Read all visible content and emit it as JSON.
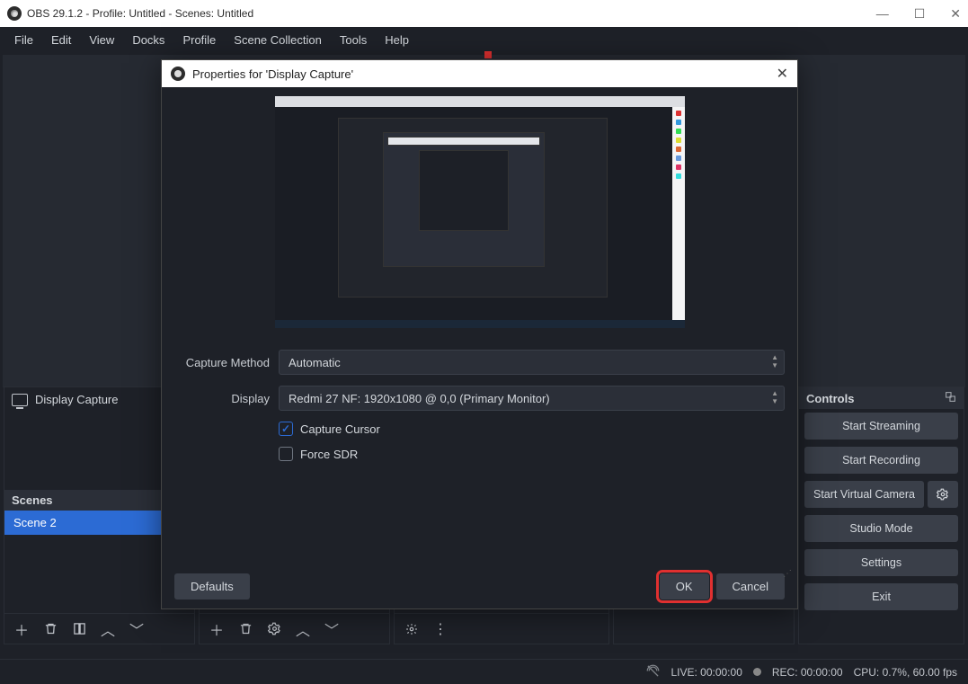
{
  "window": {
    "title": "OBS 29.1.2 - Profile: Untitled - Scenes: Untitled"
  },
  "menubar": [
    "File",
    "Edit",
    "View",
    "Docks",
    "Profile",
    "Scene Collection",
    "Tools",
    "Help"
  ],
  "panels": {
    "scenes": {
      "title": "Scenes",
      "items": [
        "Scene 2"
      ]
    },
    "sources": {
      "items": [
        "Display Capture"
      ]
    },
    "controls": {
      "title": "Controls",
      "buttons": {
        "start_streaming": "Start Streaming",
        "start_recording": "Start Recording",
        "start_virtual_camera": "Start Virtual Camera",
        "studio_mode": "Studio Mode",
        "settings": "Settings",
        "exit": "Exit"
      }
    }
  },
  "statusbar": {
    "live": "LIVE: 00:00:00",
    "rec": "REC: 00:00:00",
    "cpu": "CPU: 0.7%, 60.00 fps"
  },
  "dialog": {
    "title": "Properties for 'Display Capture'",
    "fields": {
      "capture_method_label": "Capture Method",
      "capture_method_value": "Automatic",
      "display_label": "Display",
      "display_value": "Redmi 27 NF: 1920x1080 @ 0,0 (Primary Monitor)",
      "capture_cursor": "Capture Cursor",
      "force_sdr": "Force SDR"
    },
    "buttons": {
      "defaults": "Defaults",
      "ok": "OK",
      "cancel": "Cancel"
    }
  }
}
